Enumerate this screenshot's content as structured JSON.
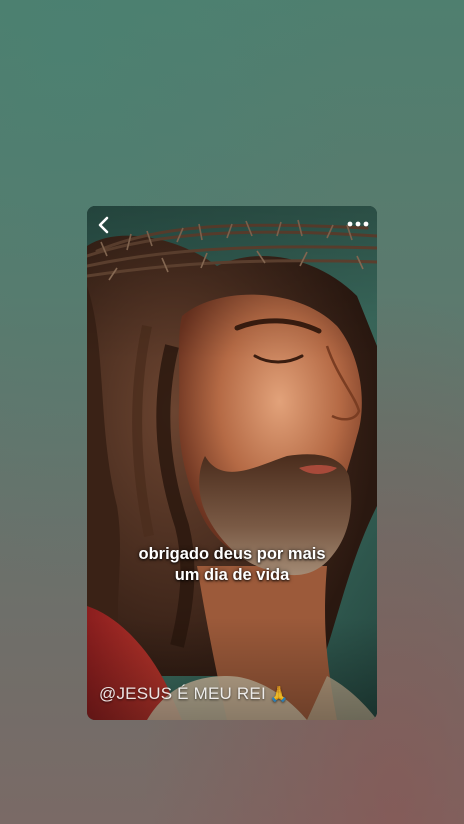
{
  "post": {
    "caption_line1": "obrigado deus por mais",
    "caption_line2": "um dia de vida",
    "watermark": "@JESUS É MEU REI",
    "watermark_emoji": "🙏"
  },
  "icons": {
    "back": "chevron-left-icon",
    "more": "more-horizontal-icon"
  },
  "colors": {
    "background_top": "#4f7f6f",
    "background_bottom": "#7a6a66",
    "caption_text": "#ffffff"
  }
}
